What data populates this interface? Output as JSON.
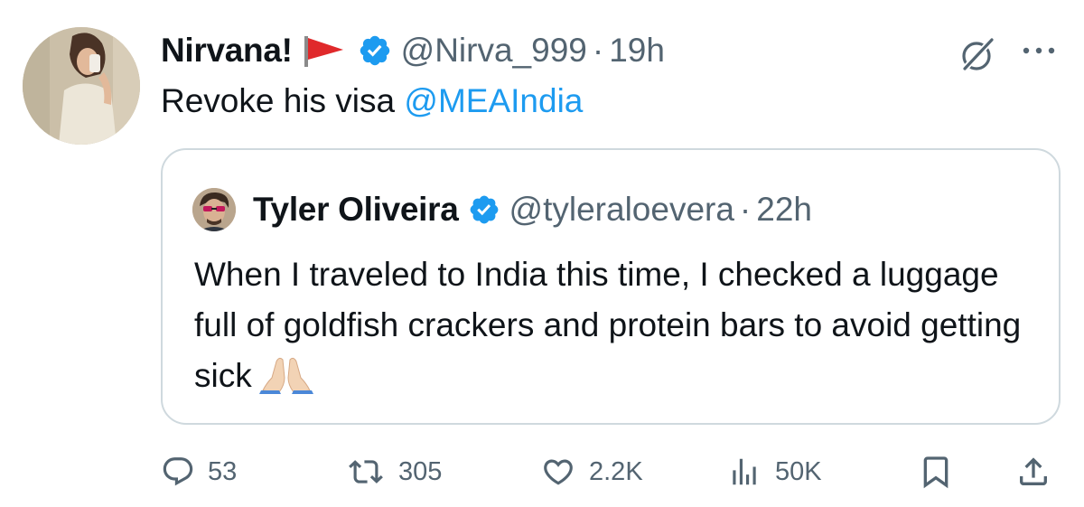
{
  "author": {
    "display_name": "Nirvana!",
    "handle": "@Nirva_999",
    "separator": "·",
    "time": "19h"
  },
  "tweet": {
    "text": "Revoke his visa ",
    "mention": "@MEAIndia"
  },
  "quoted": {
    "display_name": "Tyler Oliveira",
    "handle": "@tyleraloevera",
    "separator": "·",
    "time": "22h",
    "text": "When I traveled to India this time, I checked a luggage full of goldfish crackers and protein bars to avoid getting sick"
  },
  "stats": {
    "replies": "53",
    "reposts": "305",
    "likes": "2.2K",
    "views": "50K"
  },
  "colors": {
    "accent": "#1d9bf0",
    "secondary_text": "#536471",
    "border": "#cfd9de"
  },
  "icons": {
    "flag": "red-flag-icon",
    "verified": "verified-badge-icon",
    "grok": "grok-icon",
    "more": "more-icon",
    "reply": "reply-icon",
    "repost": "repost-icon",
    "like": "heart-icon",
    "views": "views-icon",
    "bookmark": "bookmark-icon",
    "share": "share-icon",
    "emoji": "folded-hands-icon"
  }
}
